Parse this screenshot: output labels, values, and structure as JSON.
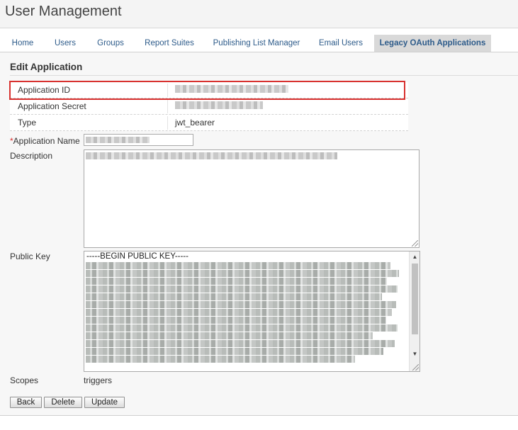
{
  "header": {
    "title": "User Management"
  },
  "tabs": [
    {
      "label": "Home"
    },
    {
      "label": "Users"
    },
    {
      "label": "Groups"
    },
    {
      "label": "Report Suites"
    },
    {
      "label": "Publishing List Manager"
    },
    {
      "label": "Email Users"
    },
    {
      "label": "Legacy OAuth Applications",
      "active": true
    }
  ],
  "form": {
    "section_title": "Edit Application",
    "info_rows": [
      {
        "label": "Application ID",
        "value": "",
        "redacted": true
      },
      {
        "label": "Application Secret",
        "value": "",
        "redacted": true
      },
      {
        "label": "Type",
        "value": "jwt_bearer"
      }
    ],
    "required_marker": "*",
    "name_label": "Application Name",
    "description_label": "Description",
    "public_key_label": "Public Key",
    "public_key_header": "-----BEGIN PUBLIC KEY-----",
    "scopes_label": "Scopes",
    "scopes_value": "triggers"
  },
  "buttons": {
    "back": "Back",
    "delete": "Delete",
    "update": "Update"
  },
  "colors": {
    "accent_link": "#2d5b8a",
    "highlight_border": "#d8312f",
    "active_tab_bg": "#d9d9d9"
  }
}
